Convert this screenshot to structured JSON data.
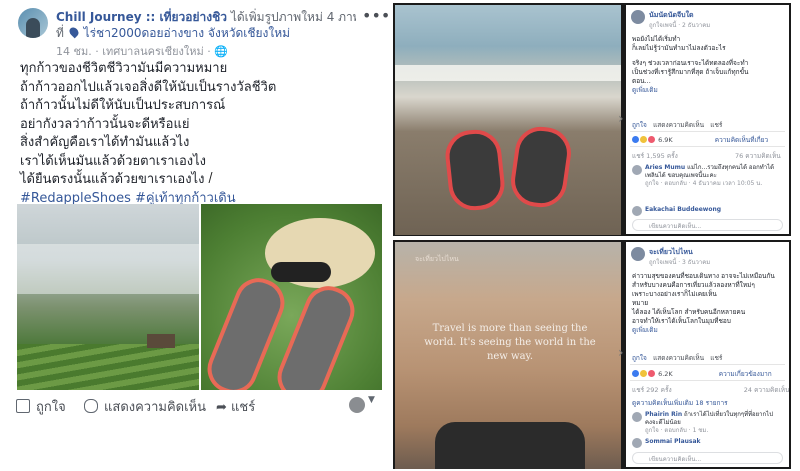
{
  "left_post": {
    "page_name": "Chill Journey :: เที่ยวอย่างชิว",
    "header_action": "ได้เพิ่มรูปภาพใหม่ 4 ภาพ —",
    "at_prefix": "ที่",
    "location": "ไร่ชา2000ดอยอ่างขาง จังหวัดเชียงใหม่",
    "meta": "14 ชม. · เทศบาลนครเชียงใหม่ · ",
    "caption_lines": [
      "ทุกก้าวของชีวิตชีวิวามันมีความหมาย",
      "ถ้าก้าวออกไปแล้วเจอสิ่งดีให้นับเป็นรางวัลชีวิต",
      "ถ้าก้าวนั้นไม่ดีให้นับเป็นประสบการณ์",
      "อย่ากังวลว่าก้าวนั้นจะดีหรือแย่",
      "สิ่งสำคัญคือเราได้ทำมันแล้วไง",
      "เราได้เห็นมันแล้วด้วยตาเราเองไง",
      "ได้ยืนตรงนั้นแล้วด้วยขาเราเองไง"
    ],
    "hashtags": "#RedappleShoes #คู่เท้าทุกก้าวเดิน",
    "actions": {
      "like": "ถูกใจ",
      "comment": "แสดงความคิดเห็น",
      "share": "แชร์"
    }
  },
  "panel_top": {
    "name": "นัมนัดนัดจีบใด",
    "meta": "ถูกใจเพจนี้ · 2 ธันวาคม",
    "text_lines": [
      "พอยังไม่ได้เริ่มทำ",
      "ก็เลยไม่รู้ว่ามันทำมาไม่ลงตัวอะไร",
      "",
      "จริงๆ ช่วงเวลาก่อนเราจะได้ทดลองที่จะทำ",
      "เป็นช่วงที่เรารู้สึกมากที่สุด ถ้าเจ็บแก้ทุกขั้น",
      "ตอน..."
    ],
    "see_more": "ดูเพิ่มเติม",
    "like": "ถูกใจ",
    "comment": "แสดงความคิดเห็น",
    "share": "แชร์",
    "reactions": "6.9K",
    "reactions_label": "ความคิดเห็นที่เกี่ยว",
    "shares": "แชร์ 1,595 ครั้ง",
    "comments_count": "76 ความคิดเห็น",
    "comments": [
      {
        "name": "Aries Mumu",
        "text": "แม่ไก...รวมถึงทุกคนได้ ออกทำได้เพลินได้ ขอบคุณเพจนี้นะคะ",
        "meta": "ถูกใจ · ตอบกลับ · 4 ธันวาคม เวลา 10:05 น."
      },
      {
        "name": "Eakachai Buddeewong",
        "text": "",
        "meta": ""
      }
    ],
    "write_comment": "เขียนความคิดเห็น..."
  },
  "panel_bottom": {
    "name": "จะเที่ยวไปไหน",
    "meta": "ถูกใจเพจนี้ · 3 ธันวาคม",
    "image_overlay": "จะเที่ยวไปไหน",
    "quote": "Travel is more than seeing the world. It's seeing the world in the new way.",
    "text_lines": [
      "ค่าวามสุขของคนที่ชอบเดินทาง อาจจะไม่เหมือนกัน",
      "สำหรับบางคนคือการเที่ยวแล้วลองหาที่ใหม่ๆ",
      "เพราะบางอย่างเราก็ไม่เคยเห็น",
      "หมาย",
      "ได้ลอง ได้เห็นโลก สำหรับคนอีกหลายคน",
      "อาจทำให้เราได้เห็นโลกในมุมที่ชอบ"
    ],
    "see_more": "ดูเพิ่มเติม",
    "like": "ถูกใจ",
    "comment": "แสดงความคิดเห็น",
    "share": "แชร์",
    "reactions": "6.2K",
    "reactions_label": "ความเกี่ยวข้องมาก",
    "shares": "แชร์ 292 ครั้ง",
    "comments_count": "24 ความคิดเห็น",
    "view_more": "ดูความคิดเห็นเพิ่มเติม 18 รายการ",
    "comments": [
      {
        "name": "Phairin Rin",
        "text": "ถ้าเราได้ไปเที่ยวในทุกๆที่ที่อยากไปคงจะดีไม่น้อย",
        "meta": "ถูกใจ · ตอบกลับ · 1 ชม."
      },
      {
        "name": "Sommai Plausak",
        "text": "",
        "meta": ""
      }
    ],
    "write_comment": "เขียนความคิดเห็น..."
  },
  "colors": {
    "link": "#365899",
    "accent_red": "#e04a4a"
  }
}
